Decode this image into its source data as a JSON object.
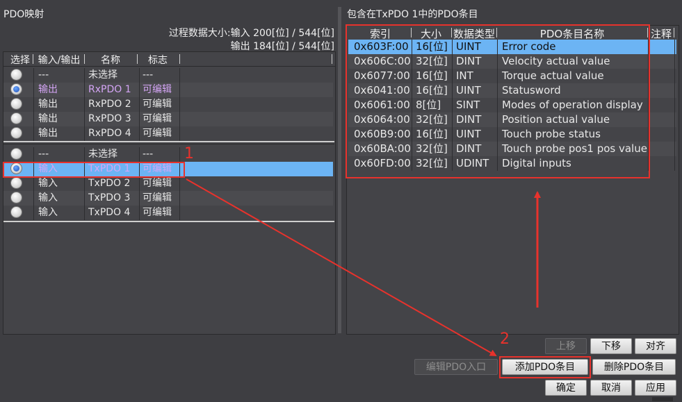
{
  "left": {
    "title": "PDO映射",
    "info_line1": "过程数据大小:输入 200[位] / 544[位]",
    "info_line2": "输出 184[位] / 544[位]",
    "headers": [
      "选择",
      "输入/输出",
      "名称",
      "标志"
    ],
    "rx_rows": [
      {
        "io": "---",
        "name": "未选择",
        "flag": "---",
        "selected": false
      },
      {
        "io": "输出",
        "name": "RxPDO 1",
        "flag": "可编辑",
        "selected": true
      },
      {
        "io": "输出",
        "name": "RxPDO 2",
        "flag": "可编辑",
        "selected": false
      },
      {
        "io": "输出",
        "name": "RxPDO 3",
        "flag": "可编辑",
        "selected": false
      },
      {
        "io": "输出",
        "name": "RxPDO 4",
        "flag": "可编辑",
        "selected": false
      }
    ],
    "tx_rows": [
      {
        "io": "---",
        "name": "未选择",
        "flag": "---",
        "selected": false
      },
      {
        "io": "输入",
        "name": "TxPDO 1",
        "flag": "可编辑",
        "selected": true
      },
      {
        "io": "输入",
        "name": "TxPDO 2",
        "flag": "可编辑",
        "selected": false
      },
      {
        "io": "输入",
        "name": "TxPDO 3",
        "flag": "可编辑",
        "selected": false
      },
      {
        "io": "输入",
        "name": "TxPDO 4",
        "flag": "可编辑",
        "selected": false
      }
    ]
  },
  "right": {
    "title": "包含在TxPDO 1中的PDO条目",
    "headers": [
      "索引",
      "大小",
      "数据类型",
      "PDO条目名称",
      "注释"
    ],
    "rows": [
      {
        "index": "0x603F:00",
        "size": "16[位]",
        "type": "UINT",
        "name": "Error code"
      },
      {
        "index": "0x606C:00",
        "size": "32[位]",
        "type": "DINT",
        "name": "Velocity actual value"
      },
      {
        "index": "0x6077:00",
        "size": "16[位]",
        "type": "INT",
        "name": "Torque actual value"
      },
      {
        "index": "0x6041:00",
        "size": "16[位]",
        "type": "UINT",
        "name": "Statusword"
      },
      {
        "index": "0x6061:00",
        "size": "8[位]",
        "type": "SINT",
        "name": "Modes of operation display"
      },
      {
        "index": "0x6064:00",
        "size": "32[位]",
        "type": "DINT",
        "name": "Position actual value"
      },
      {
        "index": "0x60B9:00",
        "size": "16[位]",
        "type": "UINT",
        "name": "Touch probe status"
      },
      {
        "index": "0x60BA:00",
        "size": "32[位]",
        "type": "DINT",
        "name": "Touch probe pos1 pos value"
      },
      {
        "index": "0x60FD:00",
        "size": "32[位]",
        "type": "UDINT",
        "name": "Digital inputs"
      }
    ]
  },
  "buttons": {
    "move_up": "上移",
    "move_down": "下移",
    "align": "对齐",
    "edit_entry": "编辑PDO入口",
    "add_entry": "添加PDO条目",
    "delete_entry": "删除PDO条目",
    "ok": "确定",
    "cancel": "取消",
    "apply": "应用"
  },
  "annotations": {
    "step1": "1",
    "step2": "2"
  },
  "colors": {
    "background": "#3e3e42",
    "selection": "#6cb4f4",
    "highlight_red": "#e8322c",
    "editable_purple": "#d4a5f5"
  }
}
